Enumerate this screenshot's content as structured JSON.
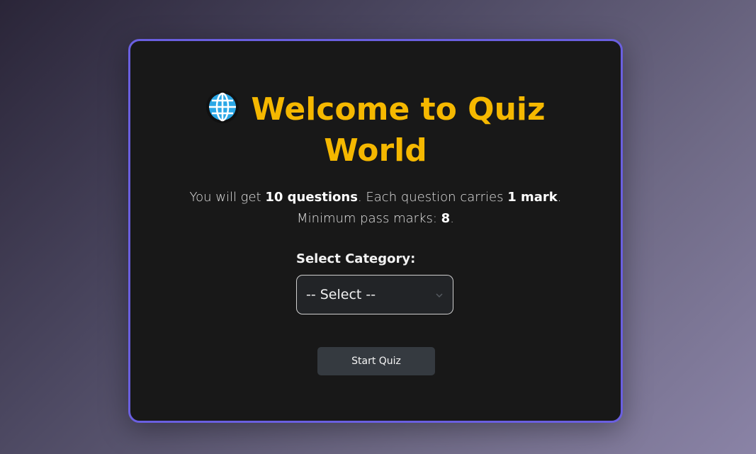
{
  "card": {
    "title_line1": "Welcome to Quiz",
    "title_line2": "World",
    "intro": {
      "part1": "You will get ",
      "questions": "10 questions",
      "part2": ". Each question carries ",
      "mark": "1 mark",
      "part3": ".",
      "part4": "Minimum pass marks: ",
      "pass_marks": "8",
      "part5": "."
    },
    "category_label": "Select Category:",
    "category_select_value": "-- Select --",
    "start_button": "Start Quiz"
  },
  "icons": {
    "title_icon": "globe-icon",
    "select_icon": "chevron-down-icon"
  },
  "colors": {
    "accent_border": "#6a5fe0",
    "title": "#f5b800",
    "card_bg": "#181818",
    "button_bg": "#353a40"
  }
}
